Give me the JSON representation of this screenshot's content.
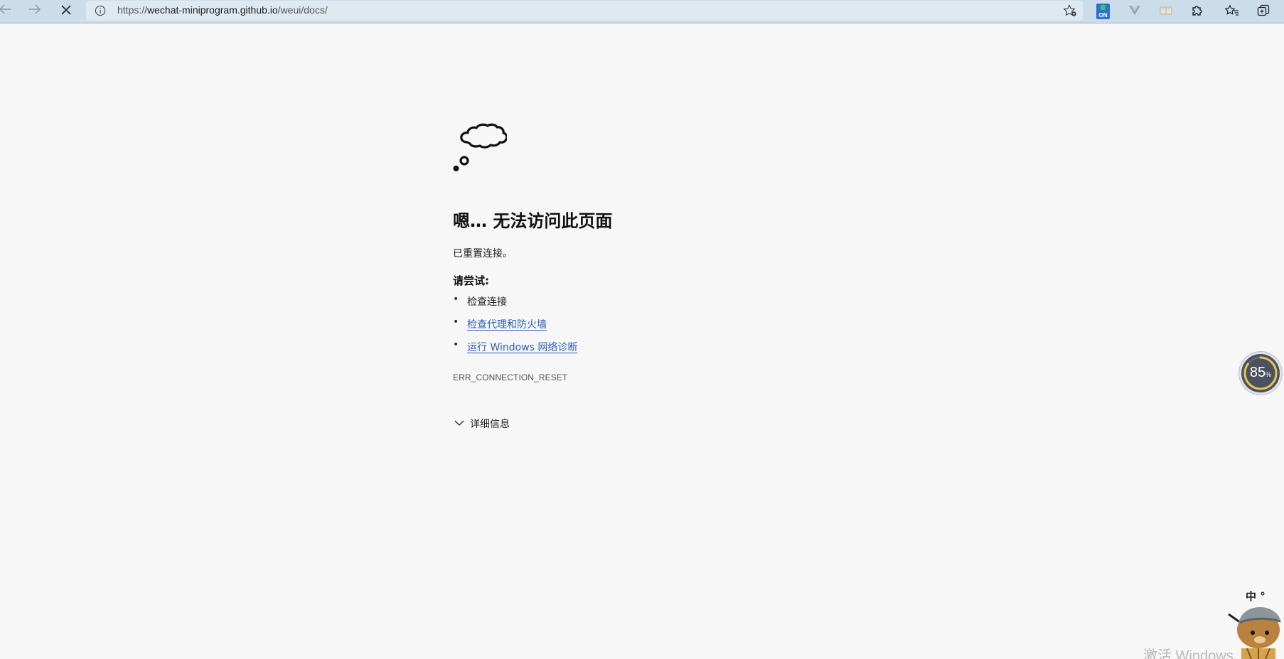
{
  "browser": {
    "url": {
      "protocol": "https://",
      "host": "wechat-miniprogram.github.io",
      "path": "/weui/docs/"
    },
    "extension_badge": "ON"
  },
  "error_page": {
    "title": "嗯… 无法访问此页面",
    "description": "已重置连接。",
    "try_heading": "请尝试:",
    "suggestions": [
      {
        "label": "检查连接",
        "is_link": false
      },
      {
        "label": "检查代理和防火墙",
        "is_link": true
      },
      {
        "label": "运行 Windows 网络诊断",
        "is_link": true
      }
    ],
    "error_code": "ERR_CONNECTION_RESET",
    "details_label": "详细信息"
  },
  "overlay": {
    "gauge_value": "85",
    "gauge_unit": "%",
    "gauge_fraction": 0.85,
    "ime_label": "中 °",
    "watermark": "激活 Windows"
  },
  "colors": {
    "toolbar_bg": "#cbdcea",
    "page_bg": "#f7f7f7",
    "link": "#2c5fb3"
  }
}
